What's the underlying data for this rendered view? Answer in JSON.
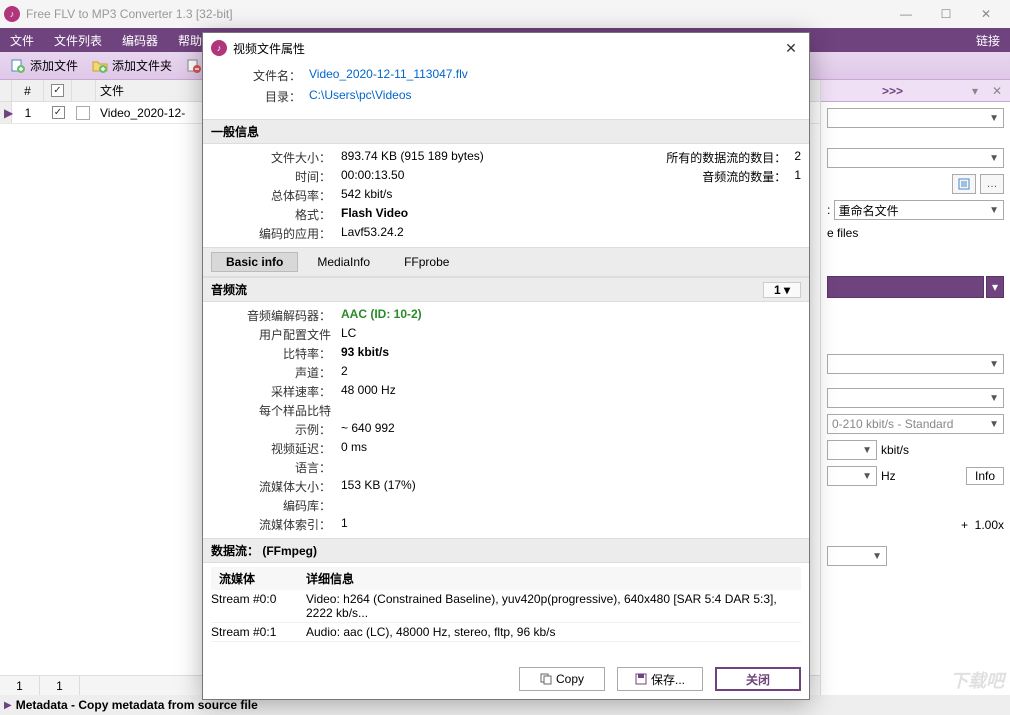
{
  "window": {
    "title": "Free FLV to MP3 Converter 1.3  [32-bit]"
  },
  "menu": {
    "file": "文件",
    "filelist": "文件列表",
    "encoder": "编码器",
    "help": "帮助",
    "link": "链接"
  },
  "toolbar": {
    "addfile": "添加文件",
    "addfolder": "添加文件夹"
  },
  "filelist": {
    "col_num": "#",
    "col_file": "文件",
    "more": ">>>",
    "row": {
      "num": "1",
      "name": "Video_2020-12-"
    },
    "footer": {
      "a": "1",
      "b": "1"
    }
  },
  "right": {
    "overwrite_label": "重命名文件",
    "files_suffix": "e files",
    "bitrate_range": "0-210 kbit/s - Standard",
    "unit_kbit": "kbit/s",
    "unit_hz": "Hz",
    "info_btn": "Info",
    "plus": "+",
    "speed": "1.00x"
  },
  "statusbar": {
    "text": "Metadata - Copy metadata from source file"
  },
  "modal": {
    "title": "视频文件属性",
    "hdr_file_lbl": "文件名：",
    "hdr_file_val": "Video_2020-12-11_113047.flv",
    "hdr_dir_lbl": "目录：",
    "hdr_dir_val": "C:\\Users\\pc\\Videos",
    "general_title": "一般信息",
    "general": {
      "size_lbl": "文件大小：",
      "size_val": "893.74 KB (915 189 bytes)",
      "time_lbl": "时间：",
      "time_val": "00:00:13.50",
      "totbr_lbl": "总体码率：",
      "totbr_val": "542 kbit/s",
      "fmt_lbl": "格式：",
      "fmt_val": "Flash Video",
      "enc_lbl": "编码的应用：",
      "enc_val": "Lavf53.24.2",
      "streams_lbl": "所有的数据流的数目：",
      "streams_val": "2",
      "audio_cnt_lbl": "音频流的数量：",
      "audio_cnt_val": "1"
    },
    "subtabs": {
      "basic": "Basic info",
      "media": "MediaInfo",
      "ffprobe": "FFprobe"
    },
    "audio_title": "音频流",
    "audio_count": "1",
    "audio": {
      "codec_lbl": "音频编解码器：",
      "codec_val": "AAC (ID: 10-2)",
      "profile_lbl": "用户配置文件",
      "profile_val": "LC",
      "bitrate_lbl": "比特率：",
      "bitrate_val": "93 kbit/s",
      "channels_lbl": "声道：",
      "channels_val": "2",
      "srate_lbl": "采样速率：",
      "srate_val": "48 000 Hz",
      "bits_lbl": "每个样品比特",
      "example_lbl": "示例：",
      "example_val": "~ 640 992",
      "vdelay_lbl": "视频延迟：",
      "vdelay_val": "0 ms",
      "lang_lbl": "语言：",
      "ssize_lbl": "流媒体大小：",
      "ssize_val": "153 KB (17%)",
      "codelib_lbl": "编码库：",
      "sindex_lbl": "流媒体索引：",
      "sindex_val": "1"
    },
    "data_title": "数据流：  (FFmpeg)",
    "data_col1": "流媒体",
    "data_col2": "详细信息",
    "stream0_id": "Stream #0:0",
    "stream0_info": "Video: h264 (Constrained Baseline), yuv420p(progressive), 640x480 [SAR 5:4 DAR 5:3], 2222 kb/s...",
    "stream1_id": "Stream #0:1",
    "stream1_info": "Audio: aac (LC), 48000 Hz, stereo, fltp, 96 kb/s",
    "btn_copy": "Copy",
    "btn_save": "保存...",
    "btn_close": "关闭"
  },
  "watermark": "下载吧"
}
